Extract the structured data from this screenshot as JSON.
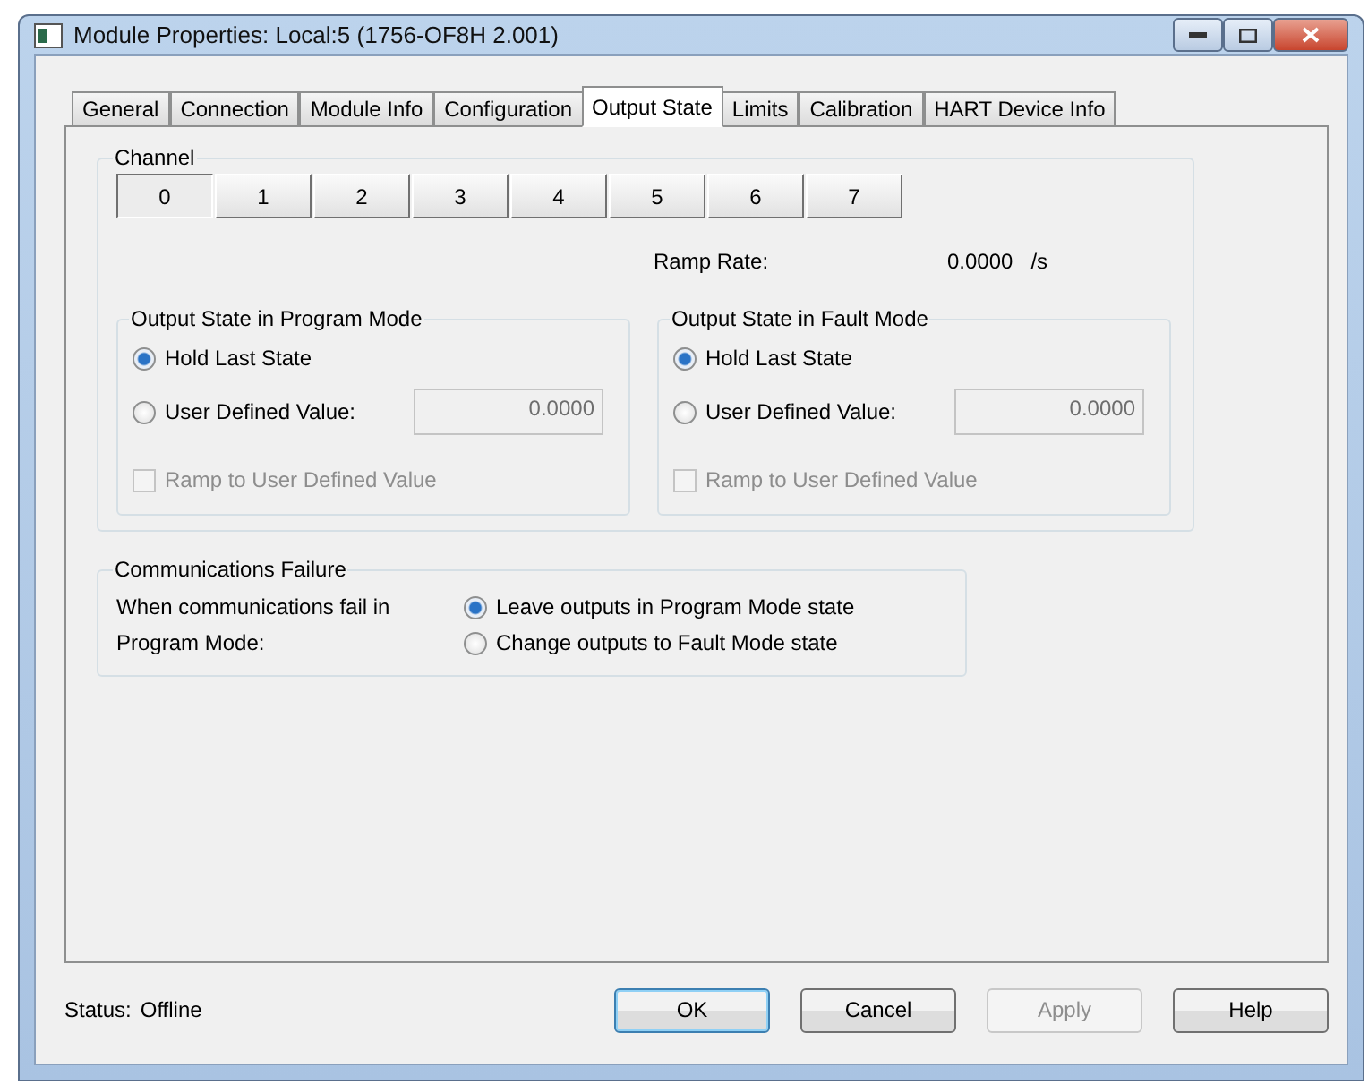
{
  "window": {
    "title": "Module Properties: Local:5 (1756-OF8H 2.001)"
  },
  "tabs": [
    {
      "label": "General",
      "selected": false
    },
    {
      "label": "Connection",
      "selected": false
    },
    {
      "label": "Module Info",
      "selected": false
    },
    {
      "label": "Configuration",
      "selected": false
    },
    {
      "label": "Output State",
      "selected": true
    },
    {
      "label": "Limits",
      "selected": false
    },
    {
      "label": "Calibration",
      "selected": false
    },
    {
      "label": "HART Device Info",
      "selected": false
    }
  ],
  "channel": {
    "title": "Channel",
    "buttons": [
      {
        "label": "0",
        "selected": true
      },
      {
        "label": "1",
        "selected": false
      },
      {
        "label": "2",
        "selected": false
      },
      {
        "label": "3",
        "selected": false
      },
      {
        "label": "4",
        "selected": false
      },
      {
        "label": "5",
        "selected": false
      },
      {
        "label": "6",
        "selected": false
      },
      {
        "label": "7",
        "selected": false
      }
    ],
    "ramp_rate": {
      "label": "Ramp Rate:",
      "value": "0.0000",
      "unit": "/s"
    }
  },
  "output_groups": [
    {
      "title": "Output State in Program Mode",
      "options": [
        {
          "label": "Hold Last State",
          "selected": true
        },
        {
          "label": "User Defined Value:",
          "selected": false,
          "value": "0.0000",
          "disabled": true
        }
      ],
      "ramp": {
        "label": "Ramp to User Defined Value",
        "checked": false,
        "disabled": true
      }
    },
    {
      "title": "Output State in Fault Mode",
      "options": [
        {
          "label": "Hold Last State",
          "selected": true
        },
        {
          "label": "User Defined Value:",
          "selected": false,
          "value": "0.0000",
          "disabled": true
        }
      ],
      "ramp": {
        "label": "Ramp to User Defined Value",
        "checked": false,
        "disabled": true
      }
    }
  ],
  "communications_failure": {
    "title": "Communications Failure",
    "prompt": "When communications fail in Program Mode:",
    "options": [
      {
        "label": "Leave outputs in Program Mode state",
        "selected": true
      },
      {
        "label": "Change outputs to Fault Mode state",
        "selected": false
      }
    ]
  },
  "status": {
    "label": "Status:",
    "value": "Offline"
  },
  "buttons": [
    {
      "label": "OK",
      "default": true,
      "disabled": false
    },
    {
      "label": "Cancel",
      "default": false,
      "disabled": false
    },
    {
      "label": "Apply",
      "default": false,
      "disabled": true
    },
    {
      "label": "Help",
      "default": false,
      "disabled": false
    }
  ]
}
